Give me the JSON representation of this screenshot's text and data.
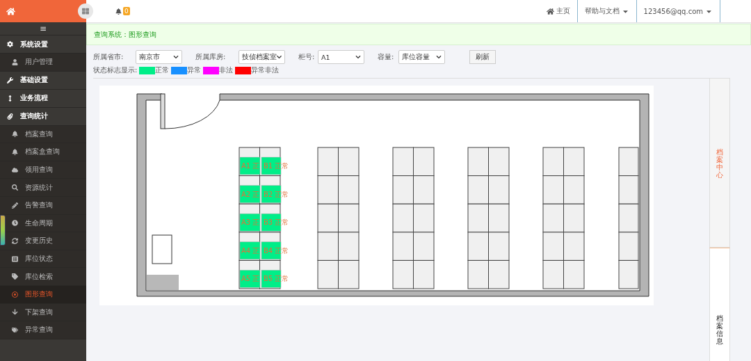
{
  "header": {
    "notification_count": "0",
    "links": [
      {
        "label": "主页",
        "kind": "home"
      },
      {
        "label": "帮助与文档",
        "kind": "menu"
      },
      {
        "label": "123456@qq.com",
        "kind": "menu"
      }
    ]
  },
  "sidebar": {
    "toggle": "≡",
    "items": [
      {
        "label": "系统设置",
        "kind": "group",
        "selected": false
      },
      {
        "label": "用户管理",
        "kind": "sub",
        "selected": false
      },
      {
        "label": "基础设置",
        "kind": "group",
        "selected": false
      },
      {
        "label": "业务流程",
        "kind": "group",
        "selected": false
      },
      {
        "label": "查询统计",
        "kind": "group",
        "selected": false
      },
      {
        "label": "档案查询",
        "kind": "sub",
        "selected": false
      },
      {
        "label": "档案盒查询",
        "kind": "sub",
        "selected": false
      },
      {
        "label": "领用查询",
        "kind": "sub",
        "selected": false
      },
      {
        "label": "资源统计",
        "kind": "sub",
        "selected": false
      },
      {
        "label": "告警查询",
        "kind": "sub",
        "selected": false
      },
      {
        "label": "生命周期",
        "kind": "sub",
        "selected": false
      },
      {
        "label": "变更历史",
        "kind": "sub",
        "selected": false
      },
      {
        "label": "库位状态",
        "kind": "sub",
        "selected": false
      },
      {
        "label": "库位检索",
        "kind": "sub",
        "selected": false
      },
      {
        "label": "图形查询",
        "kind": "sub",
        "selected": true
      },
      {
        "label": "下架查询",
        "kind": "sub",
        "selected": false
      },
      {
        "label": "异常查询",
        "kind": "sub",
        "selected": false
      }
    ]
  },
  "breadcrumb": "查询系统：图形查询",
  "filters": [
    {
      "label": "所属省市:",
      "value": "南京市"
    },
    {
      "label": "所属库房:",
      "value": "技侦档案室"
    },
    {
      "label": "柜号:",
      "value": "A1"
    },
    {
      "label": "容量:",
      "value": "库位容量"
    }
  ],
  "refresh_button": "刷新",
  "legend": {
    "label": "状态标志显示:",
    "items": [
      {
        "label": "正常",
        "color": "#00ee88"
      },
      {
        "label": "异常",
        "color": "#1890ff"
      },
      {
        "label": "非法",
        "color": "#ff00ff"
      },
      {
        "label": "异常非法",
        "color": "#ff0000"
      }
    ]
  },
  "slots": [
    {
      "a": {
        "label": "A1 正",
        "color": "#00ee88"
      },
      "b": {
        "label": "B1 正常",
        "color": "#00ee88"
      }
    },
    {
      "a": {
        "label": "A2 正",
        "color": "#00ee88"
      },
      "b": {
        "label": "B2 正常",
        "color": "#00ee88"
      }
    },
    {
      "a": {
        "label": "A3 正",
        "color": "#00ee88"
      },
      "b": {
        "label": "B3 正常",
        "color": "#00ee88"
      }
    },
    {
      "a": {
        "label": "A4 正",
        "color": "#00ee88"
      },
      "b": {
        "label": "B4 正常",
        "color": "#00ee88"
      }
    },
    {
      "a": {
        "label": "A5 正",
        "color": "#00ee88"
      },
      "b": {
        "label": "B5 正常",
        "color": "#00ee88"
      }
    }
  ],
  "side_tabs": [
    {
      "label": "档案中心",
      "selected": true
    },
    {
      "label": "档案信息",
      "selected": false
    }
  ]
}
